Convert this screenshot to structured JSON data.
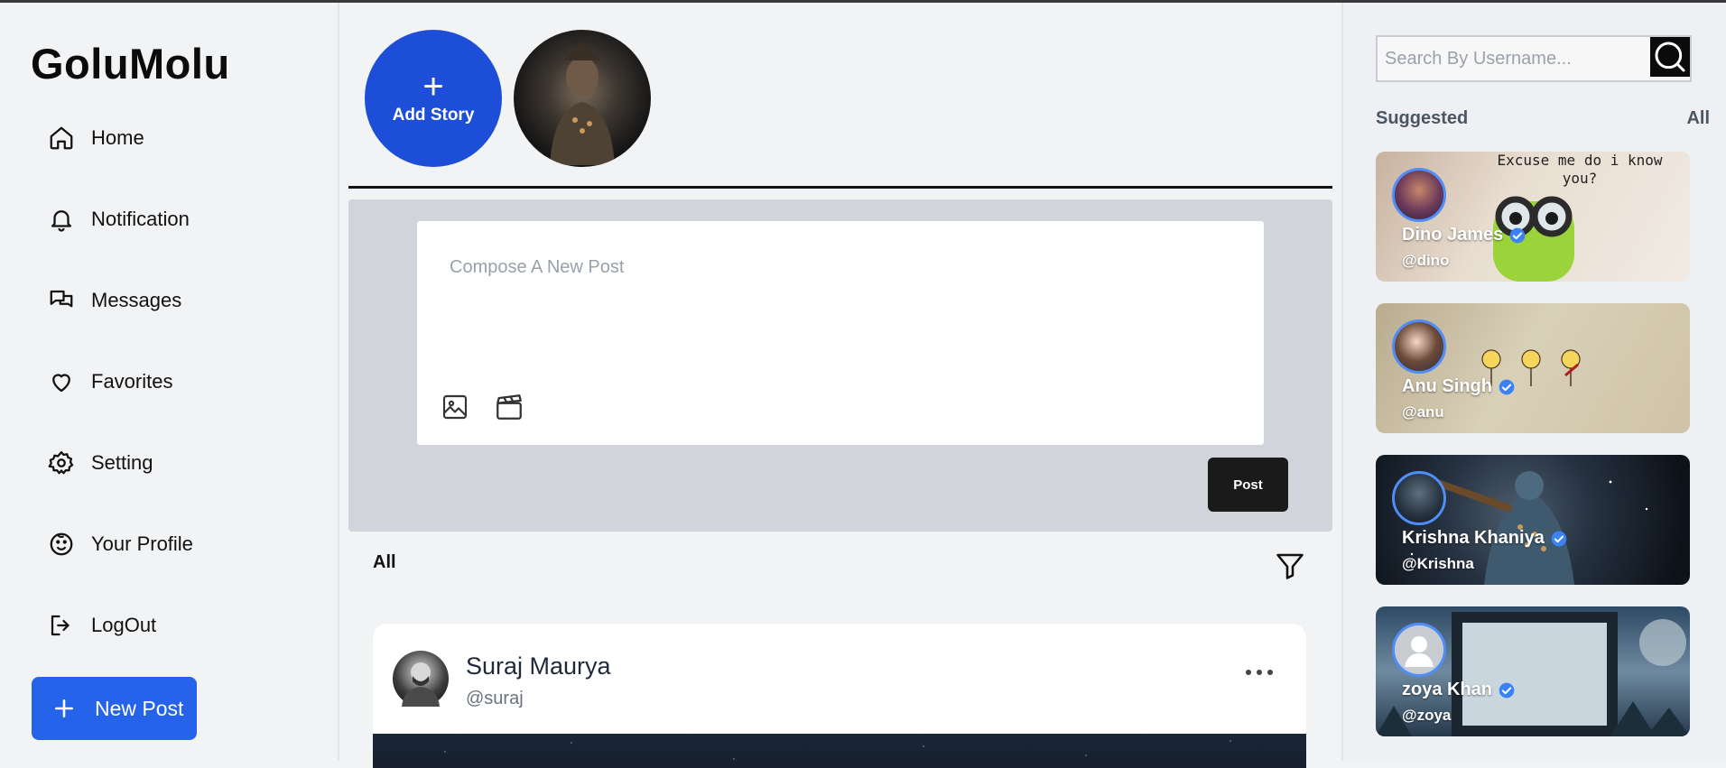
{
  "app": {
    "logo": "GoluMolu"
  },
  "sidebar": {
    "items": [
      {
        "label": "Home",
        "icon": "home-icon"
      },
      {
        "label": "Notification",
        "icon": "bell-icon"
      },
      {
        "label": "Messages",
        "icon": "chat-icon"
      },
      {
        "label": "Favorites",
        "icon": "heart-icon"
      },
      {
        "label": "Setting",
        "icon": "gear-icon"
      },
      {
        "label": "Your Profile",
        "icon": "smiley-icon"
      },
      {
        "label": "LogOut",
        "icon": "logout-icon"
      }
    ],
    "new_post_label": "New Post"
  },
  "stories": {
    "add_label": "Add Story"
  },
  "compose": {
    "placeholder": "Compose A New Post",
    "post_label": "Post"
  },
  "feed": {
    "filter_label": "All",
    "post": {
      "name": "Suraj Maurya",
      "handle": "@suraj"
    }
  },
  "search": {
    "placeholder": "Search By Username..."
  },
  "suggested": {
    "title": "Suggested",
    "all_label": "All",
    "cards": [
      {
        "name": "Dino James",
        "handle": "@dino",
        "image_text": "Excuse me do i know you?"
      },
      {
        "name": "Anu Singh",
        "handle": "@anu"
      },
      {
        "name": "Krishna Khaniya",
        "handle": "@Krishna"
      },
      {
        "name": "zoya Khan",
        "handle": "@zoya"
      }
    ]
  },
  "colors": {
    "accent": "#2563eb",
    "story_accent": "#1d4ed8",
    "background": "#f2f3f5",
    "compose_bg": "#d1d4da",
    "verified_badge": "#3b82f6"
  }
}
